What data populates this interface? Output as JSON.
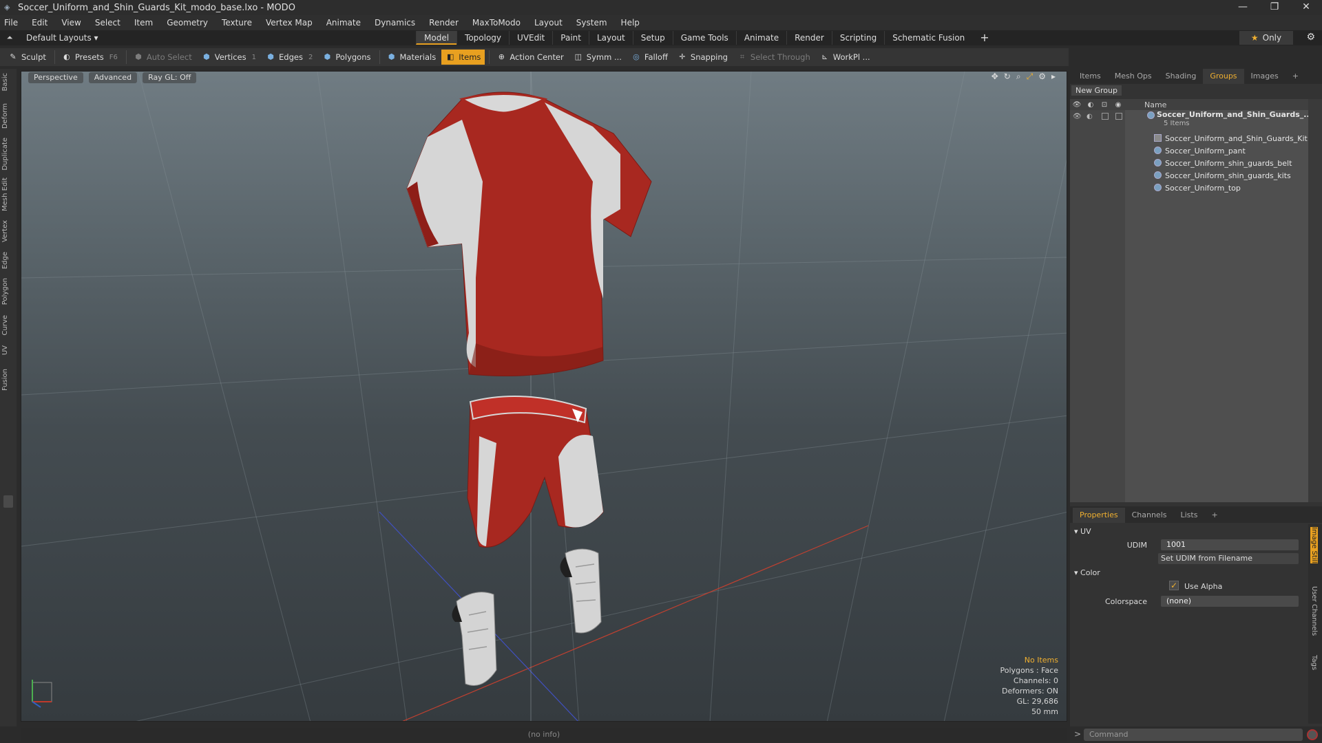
{
  "window": {
    "title": "Soccer_Uniform_and_Shin_Guards_Kit_modo_base.lxo - MODO",
    "min": "—",
    "max": "❐",
    "close": "✕"
  },
  "menu": [
    "File",
    "Edit",
    "View",
    "Select",
    "Item",
    "Geometry",
    "Texture",
    "Vertex Map",
    "Animate",
    "Dynamics",
    "Render",
    "MaxToModo",
    "Layout",
    "System",
    "Help"
  ],
  "layoutbar": {
    "layouts": "Default Layouts ▾",
    "tabs": [
      "Model",
      "Topology",
      "UVEdit",
      "Paint",
      "Layout",
      "Setup",
      "Game Tools",
      "Animate",
      "Render",
      "Scripting",
      "Schematic Fusion"
    ],
    "active_tab": "Model",
    "plus": "+",
    "only": "Only"
  },
  "toolbar": {
    "sculpt": "Sculpt",
    "presets": "Presets",
    "presets_key": "F6",
    "auto_select": "Auto Select",
    "vertices": "Vertices",
    "vertices_key": "1",
    "edges": "Edges",
    "edges_key": "2",
    "polygons": "Polygons",
    "materials": "Materials",
    "items": "Items",
    "action_center": "Action Center",
    "symmetry": "Symm ...",
    "falloff": "Falloff",
    "snapping": "Snapping",
    "select_through": "Select Through",
    "workplane": "WorkPl ..."
  },
  "left_tabs": [
    "Basic",
    "Deform",
    "Duplicate",
    "Mesh Edit",
    "Vertex",
    "Edge",
    "Polygon",
    "Curve",
    "UV",
    "Fusion"
  ],
  "viewport": {
    "view": "Perspective",
    "mode": "Advanced",
    "raygl": "Ray GL: Off",
    "info": {
      "selection": "No Items",
      "polygons": "Polygons : Face",
      "channels": "Channels: 0",
      "deformers": "Deformers: ON",
      "gl": "GL: 29,686",
      "lens": "50 mm"
    }
  },
  "status": "(no info)",
  "groups_panel": {
    "tabs": [
      "Items",
      "Mesh Ops",
      "Shading",
      "Groups",
      "Images"
    ],
    "active_tab": "Groups",
    "plus": "+",
    "new_group": "New Group",
    "col_name": "Name",
    "root": {
      "label": "Soccer_Uniform_and_Shin_Guards_...",
      "sub": "5 Items"
    },
    "children": [
      "Soccer_Uniform_and_Shin_Guards_Kit",
      "Soccer_Uniform_pant",
      "Soccer_Uniform_shin_guards_belt",
      "Soccer_Uniform_shin_guards_kits",
      "Soccer_Uniform_top"
    ]
  },
  "properties": {
    "tabs": [
      "Properties",
      "Channels",
      "Lists"
    ],
    "active_tab": "Properties",
    "plus": "+",
    "uv_section": "UV",
    "udim_label": "UDIM",
    "udim_value": "1001",
    "set_udim": "Set UDIM from Filename",
    "color_section": "Color",
    "use_alpha": "Use Alpha",
    "colorspace_label": "Colorspace",
    "colorspace_value": "(none)",
    "side_tabs": [
      "Image Still",
      "User Channels",
      "Tags"
    ]
  },
  "command": {
    "prompt": ">",
    "placeholder": "Command"
  },
  "colors": {
    "accent": "#e8a020",
    "shirt_red": "#a82820",
    "shirt_white": "#d8d8d8"
  }
}
